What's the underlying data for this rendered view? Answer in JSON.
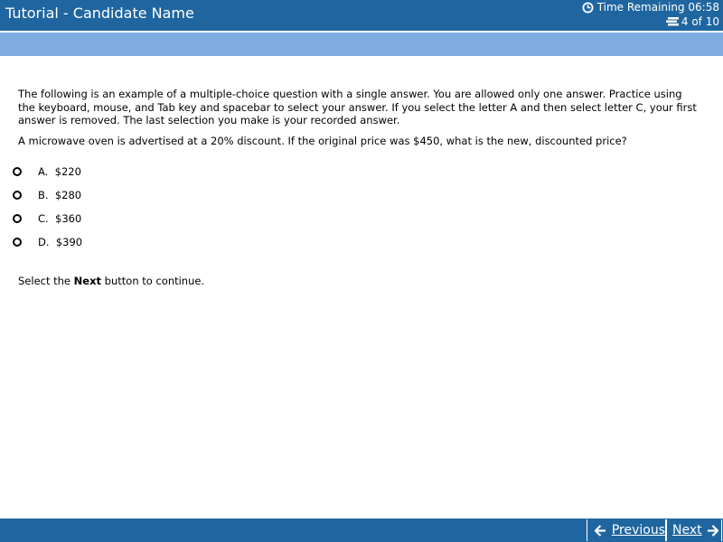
{
  "header": {
    "title": "Tutorial - Candidate Name",
    "time_remaining": "Time Remaining 06:58",
    "item_counter": "4 of 10"
  },
  "content": {
    "instructions": "The following is an example of a multiple-choice question with a single answer.  You are allowed only one answer.  Practice using the keyboard, mouse, and Tab key and spacebar to select your answer.  If you select the letter A and then select letter C, your first answer is removed.  The last selection you make is your recorded answer.",
    "question": "A microwave oven is advertised at a 20% discount.  If the original price was $450, what is the new, discounted price?",
    "options": [
      {
        "letter": "A.",
        "text": "$220"
      },
      {
        "letter": "B.",
        "text": "$280"
      },
      {
        "letter": "C.",
        "text": "$360"
      },
      {
        "letter": "D.",
        "text": "$390"
      }
    ],
    "continue_prefix": "Select the ",
    "continue_bold": "Next",
    "continue_suffix": " button to continue."
  },
  "footer": {
    "previous_label": "Previous",
    "next_label": "Next"
  },
  "colors": {
    "header_bg": "#1f66a0",
    "subbar_bg": "#7eacdf",
    "footer_bg": "#1f66a0"
  },
  "icons": {
    "timer": "clock-icon",
    "counter": "items-icon",
    "previous": "arrow-left-icon",
    "next": "arrow-right-icon"
  }
}
